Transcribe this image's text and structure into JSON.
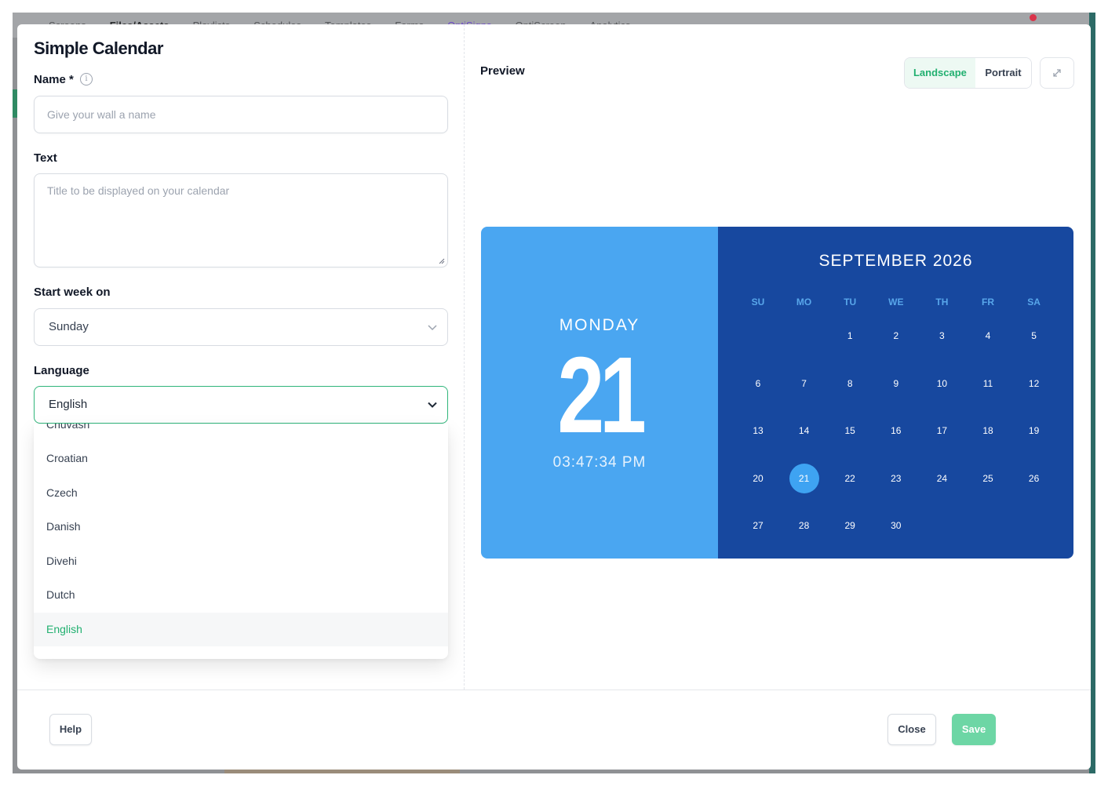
{
  "background_app": {
    "nav": [
      "Screens",
      "Files/Assets",
      "Playlists",
      "Schedules",
      "Templates",
      "Forms",
      "OptiSigns",
      "OptiScreen",
      "Analytics"
    ]
  },
  "modal": {
    "title": "Simple Calendar",
    "name_label": "Name *",
    "name_info_icon": "i",
    "name_placeholder": "Give your wall a name",
    "text_label": "Text",
    "text_placeholder": "Title to be displayed on your calendar",
    "week_label": "Start week on",
    "week_value": "Sunday",
    "language_label": "Language",
    "language_value": "English",
    "language_options": [
      "Chuvash",
      "Croatian",
      "Czech",
      "Danish",
      "Divehi",
      "Dutch",
      "English"
    ],
    "selected_language": "English"
  },
  "preview": {
    "label": "Preview",
    "orientation": {
      "landscape": "Landscape",
      "portrait": "Portrait",
      "active": "Landscape"
    },
    "expand_icon": "expand-icon"
  },
  "calendar": {
    "day_name": "MONDAY",
    "day_number": "21",
    "time": "03:47:34 PM",
    "month_title": "SEPTEMBER 2026",
    "weekdays": [
      "SU",
      "MO",
      "TU",
      "WE",
      "TH",
      "FR",
      "SA"
    ],
    "first_weekday_index": 2,
    "days_in_month": 30,
    "today": 21,
    "colors": {
      "left_bg": "#4aa6f1",
      "right_bg": "#17489f",
      "weekday_text": "#58a6ea",
      "today_bg": "#3ea3f2"
    }
  },
  "footer": {
    "help": "Help",
    "close": "Close",
    "save": "Save"
  },
  "colors": {
    "accent": "#22b070",
    "save_button": "#6dd6a5"
  }
}
